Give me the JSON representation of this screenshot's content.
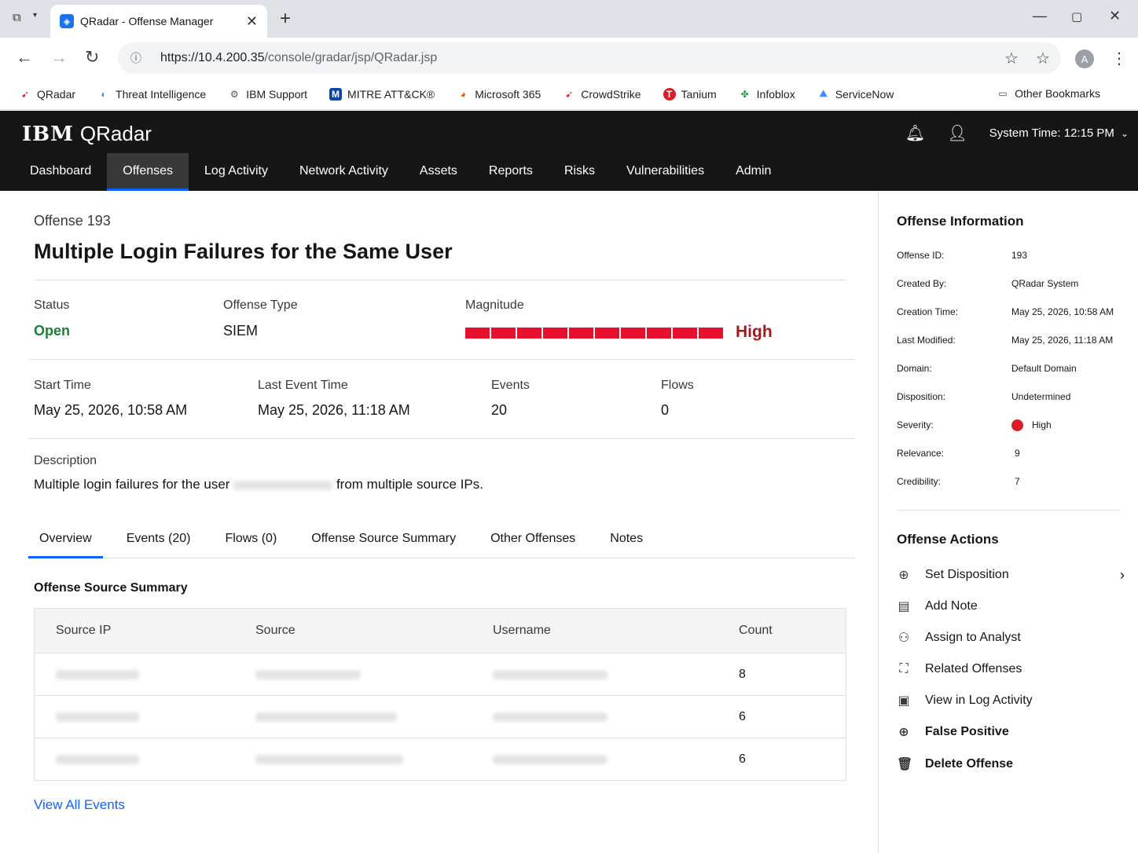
{
  "browser": {
    "tab_title": "QRadar - Offense Manager",
    "tab_close": "✕",
    "new_tab": "+",
    "url_host": "https://10.4.200.35",
    "url_path": "/console/gradar/jsp/QRadar.jsp",
    "avatar_letter": "A",
    "bookmarks": [
      "QRadar",
      "Threat Intelligence",
      "IBM Support",
      "MITRE ATT&CK®",
      "Microsoft 365",
      "CrowdStrike",
      "Tanium",
      "Infoblox",
      "ServiceNow"
    ],
    "other_bookmarks": "Other Bookmarks"
  },
  "app": {
    "brand_ibm": "IBM",
    "brand_name": "QRadar",
    "system_time": "System Time: 12:15 PM",
    "nav": [
      "Dashboard",
      "Offenses",
      "Log Activity",
      "Network Activity",
      "Assets",
      "Reports",
      "Risks",
      "Vulnerabilities",
      "Admin"
    ]
  },
  "offense": {
    "number": "Offense 193",
    "title": "Multiple Login Failures for the Same User",
    "status_label": "Status",
    "status_value": "Open",
    "type_label": "Offense Type",
    "type_value": "SIEM",
    "magnitude_label": "Magnitude",
    "magnitude_value": "High",
    "magnitude_segments": 10,
    "start_label": "Start Time",
    "start_value": "May 25, 2026, 10:58 AM",
    "last_event_label": "Last Event Time",
    "last_event_value": "May 25, 2026, 11:18 AM",
    "events_label": "Events",
    "events_value": "20",
    "flows_label": "Flows",
    "flows_value": "0",
    "description_label": "Description",
    "description_before": "Multiple login failures for the user",
    "description_after": "from multiple source IPs."
  },
  "tabs": [
    "Overview",
    "Events (20)",
    "Flows (0)",
    "Offense Source Summary",
    "Other Offenses",
    "Notes"
  ],
  "summary": {
    "title": "Offense Source Summary",
    "columns": [
      "Source IP",
      "Source",
      "Username",
      "Count"
    ],
    "rows": [
      {
        "count": "8"
      },
      {
        "count": "6"
      },
      {
        "count": "6"
      }
    ],
    "view_all": "View All Events"
  },
  "info": {
    "title": "Offense Information",
    "fields": [
      {
        "k": "Offense ID:",
        "v": "193"
      },
      {
        "k": "Created By:",
        "v": "QRadar System"
      },
      {
        "k": "Creation Time:",
        "v": "May 25, 2026, 10:58 AM"
      },
      {
        "k": "Last Modified:",
        "v": "May 25, 2026, 11:18 AM"
      },
      {
        "k": "Domain:",
        "v": "Default Domain"
      },
      {
        "k": "Disposition:",
        "v": "Undetermined"
      },
      {
        "k": "Severity:",
        "v": "High"
      },
      {
        "k": "Relevance:",
        "v": "9"
      },
      {
        "k": "Credibility:",
        "v": "7"
      }
    ]
  },
  "actions": {
    "title": "Offense Actions",
    "items": [
      "Set Disposition",
      "Add Note",
      "Assign to Analyst",
      "Related Offenses",
      "View in Log Activity",
      "False Positive",
      "Delete Offense"
    ]
  },
  "colors": {
    "accent": "#0f62fe",
    "open_status": "#198038",
    "magnitude": "#e8102e",
    "severity_high": "#da1e28",
    "header_bg": "#161616"
  }
}
